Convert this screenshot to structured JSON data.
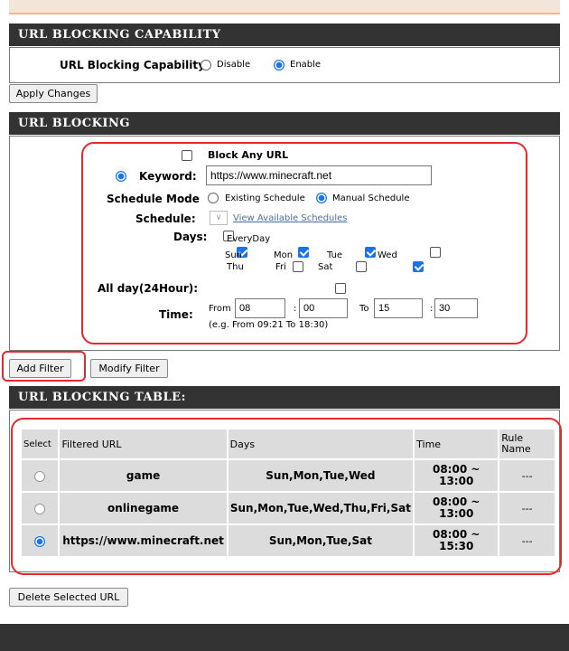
{
  "capability": {
    "header": "URL BLOCKING CAPABILITY",
    "label": "URL Blocking Capability:",
    "option_disable": "Disable",
    "option_enable": "Enable",
    "selected": "Enable",
    "apply_button": "Apply Changes"
  },
  "blocking": {
    "header": "URL BLOCKING",
    "block_any_label": "Block Any URL",
    "keyword_label": "Keyword:",
    "keyword_value": "https://www.minecraft.net",
    "schedule_mode_label": "Schedule Mode",
    "schedule_mode_existing": "Existing Schedule",
    "schedule_mode_manual": "Manual Schedule",
    "schedule_label": "Schedule:",
    "view_schedules_link": "View Available Schedules",
    "days_label": "Days:",
    "days": {
      "everyday": "EveryDay",
      "sun": "Sun",
      "mon": "Mon",
      "tue": "Tue",
      "wed": "Wed",
      "thu": "Thu",
      "fri": "Fri",
      "sat": "Sat"
    },
    "all_day_label": "All day(24Hour):",
    "time_label": "Time:",
    "from_label": "From",
    "to_label": "To",
    "from_hour": "08",
    "from_min": "00",
    "to_hour": "15",
    "to_min": "30",
    "colon": ":",
    "time_hint": "(e.g. From 09:21 To 18:30)",
    "add_filter_button": "Add Filter",
    "modify_filter_button": "Modify Filter"
  },
  "table": {
    "header": "URL BLOCKING TABLE:",
    "columns": [
      "Select",
      "Filtered URL",
      "Days",
      "Time",
      "Rule Name"
    ],
    "rows": [
      {
        "url": "game",
        "days": "Sun,Mon,Tue,Wed",
        "time_start": "08:00 ~",
        "time_end": "13:00",
        "rule": "---",
        "selected": false
      },
      {
        "url": "onlinegame",
        "days": "Sun,Mon,Tue,Wed,Thu,Fri,Sat",
        "time_start": "08:00 ~",
        "time_end": "13:00",
        "rule": "---",
        "selected": false
      },
      {
        "url": "https://www.minecraft.net",
        "days": "Sun,Mon,Tue,Sat",
        "time_start": "08:00 ~",
        "time_end": "15:30",
        "rule": "---",
        "selected": true
      }
    ],
    "delete_button": "Delete Selected URL"
  },
  "colors": {
    "section_header": "#333333",
    "highlight": "#e32b2b",
    "accent": "#1a73e8"
  }
}
